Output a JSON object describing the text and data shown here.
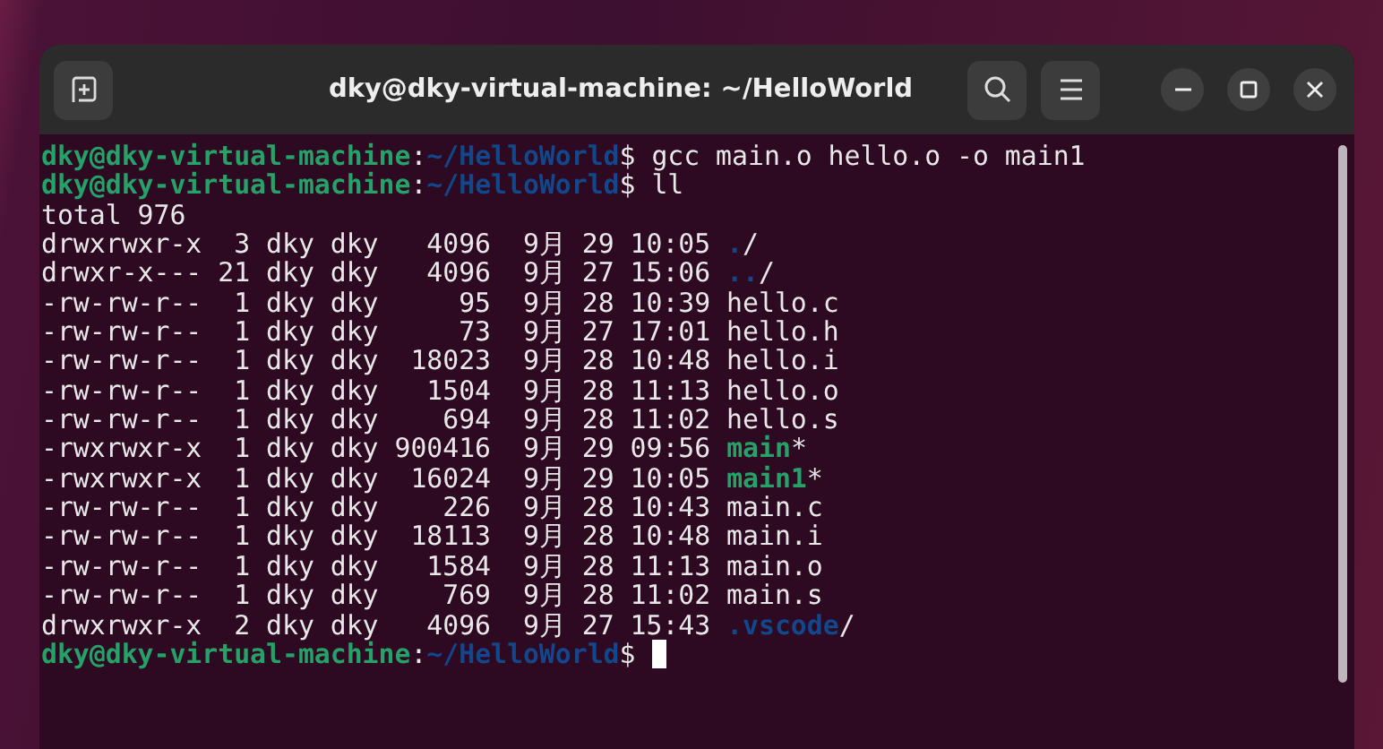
{
  "window": {
    "title": "dky@dky-virtual-machine: ~/HelloWorld"
  },
  "terminal": {
    "cursor_focused": true,
    "lines": [
      {
        "segments": [
          {
            "kind": "user",
            "text": "dky@dky-virtual-machine"
          },
          {
            "kind": "plain",
            "text": ":"
          },
          {
            "kind": "path",
            "text": "~/HelloWorld"
          },
          {
            "kind": "plain",
            "text": "$ gcc main.o hello.o -o main1"
          }
        ]
      },
      {
        "segments": [
          {
            "kind": "user",
            "text": "dky@dky-virtual-machine"
          },
          {
            "kind": "plain",
            "text": ":"
          },
          {
            "kind": "path",
            "text": "~/HelloWorld"
          },
          {
            "kind": "plain",
            "text": "$ ll"
          }
        ]
      },
      {
        "segments": [
          {
            "kind": "plain",
            "text": "total 976"
          }
        ]
      },
      {
        "segments": [
          {
            "kind": "plain",
            "text": "drwxrwxr-x  3 dky dky   4096  9月 29 10:05 "
          },
          {
            "kind": "dir",
            "text": "."
          },
          {
            "kind": "plain",
            "text": "/"
          }
        ]
      },
      {
        "segments": [
          {
            "kind": "plain",
            "text": "drwxr-x--- 21 dky dky   4096  9月 27 15:06 "
          },
          {
            "kind": "dir",
            "text": ".."
          },
          {
            "kind": "plain",
            "text": "/"
          }
        ]
      },
      {
        "segments": [
          {
            "kind": "plain",
            "text": "-rw-rw-r--  1 dky dky     95  9月 28 10:39 hello.c"
          }
        ]
      },
      {
        "segments": [
          {
            "kind": "plain",
            "text": "-rw-rw-r--  1 dky dky     73  9月 27 17:01 hello.h"
          }
        ]
      },
      {
        "segments": [
          {
            "kind": "plain",
            "text": "-rw-rw-r--  1 dky dky  18023  9月 28 10:48 hello.i"
          }
        ]
      },
      {
        "segments": [
          {
            "kind": "plain",
            "text": "-rw-rw-r--  1 dky dky   1504  9月 28 11:13 hello.o"
          }
        ]
      },
      {
        "segments": [
          {
            "kind": "plain",
            "text": "-rw-rw-r--  1 dky dky    694  9月 28 11:02 hello.s"
          }
        ]
      },
      {
        "segments": [
          {
            "kind": "plain",
            "text": "-rwxrwxr-x  1 dky dky 900416  9月 29 09:56 "
          },
          {
            "kind": "exec",
            "text": "main"
          },
          {
            "kind": "plain",
            "text": "*"
          }
        ]
      },
      {
        "segments": [
          {
            "kind": "plain",
            "text": "-rwxrwxr-x  1 dky dky  16024  9月 29 10:05 "
          },
          {
            "kind": "exec",
            "text": "main1"
          },
          {
            "kind": "plain",
            "text": "*"
          }
        ]
      },
      {
        "segments": [
          {
            "kind": "plain",
            "text": "-rw-rw-r--  1 dky dky    226  9月 28 10:43 main.c"
          }
        ]
      },
      {
        "segments": [
          {
            "kind": "plain",
            "text": "-rw-rw-r--  1 dky dky  18113  9月 28 10:48 main.i"
          }
        ]
      },
      {
        "segments": [
          {
            "kind": "plain",
            "text": "-rw-rw-r--  1 dky dky   1584  9月 28 11:13 main.o"
          }
        ]
      },
      {
        "segments": [
          {
            "kind": "plain",
            "text": "-rw-rw-r--  1 dky dky    769  9月 28 11:02 main.s"
          }
        ]
      },
      {
        "segments": [
          {
            "kind": "plain",
            "text": "drwxrwxr-x  2 dky dky   4096  9月 27 15:43 "
          },
          {
            "kind": "dir",
            "text": ".vscode"
          },
          {
            "kind": "plain",
            "text": "/"
          }
        ]
      },
      {
        "segments": [
          {
            "kind": "user",
            "text": "dky@dky-virtual-machine"
          },
          {
            "kind": "plain",
            "text": ":"
          },
          {
            "kind": "path",
            "text": "~/HelloWorld"
          },
          {
            "kind": "plain",
            "text": "$ "
          }
        ]
      }
    ]
  }
}
